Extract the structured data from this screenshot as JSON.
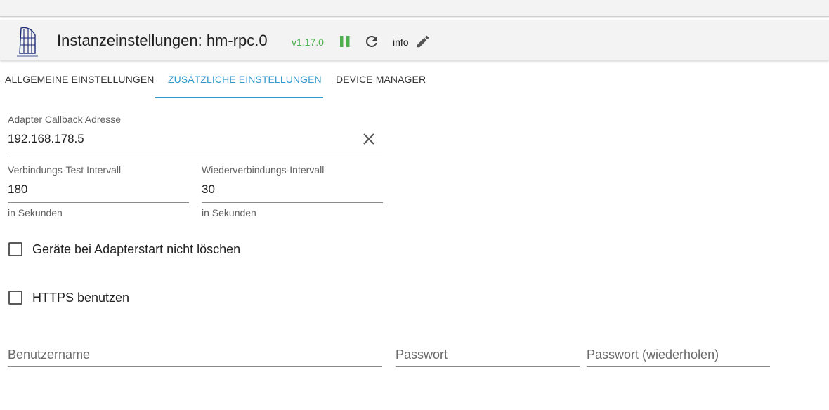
{
  "header": {
    "logo_icon": "homematic-logo",
    "title": "Instanzeinstellungen: hm-rpc.0",
    "version": "v1.17.0",
    "pause_icon": "pause-icon",
    "reload_icon": "reload-icon",
    "info_label": "info",
    "edit_icon": "pencil-icon",
    "colors": {
      "version": "#4caf50",
      "pause": "#4caf50",
      "accent": "#3399cc"
    }
  },
  "tabs": [
    {
      "label": "ALLGEMEINE EINSTELLUNGEN",
      "active": false
    },
    {
      "label": "ZUSÄTZLICHE EINSTELLUNGEN",
      "active": true
    },
    {
      "label": "DEVICE MANAGER",
      "active": false
    }
  ],
  "form": {
    "callback": {
      "label": "Adapter Callback Adresse",
      "value": "192.168.178.5",
      "clear_icon": "close-icon"
    },
    "check_interval": {
      "label": "Verbindungs-Test Intervall",
      "value": "180",
      "helper": "in Sekunden"
    },
    "reconnect_interval": {
      "label": "Wiederverbindungs-Intervall",
      "value": "30",
      "helper": "in Sekunden"
    },
    "dont_delete_devices": {
      "label": "Geräte bei Adapterstart nicht löschen",
      "checked": false
    },
    "use_https": {
      "label": "HTTPS benutzen",
      "checked": false
    },
    "username": {
      "placeholder": "Benutzername",
      "value": ""
    },
    "password": {
      "placeholder": "Passwort",
      "value": ""
    },
    "password_repeat": {
      "placeholder": "Passwort (wiederholen)",
      "value": ""
    }
  }
}
